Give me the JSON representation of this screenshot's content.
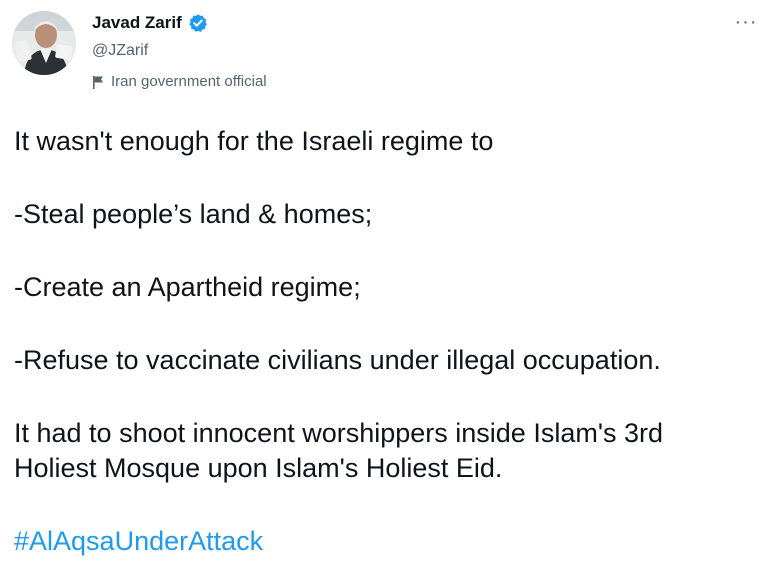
{
  "author": {
    "display_name": "Javad Zarif",
    "handle": "@JZarif",
    "label": "Iran government official",
    "verified_icon": "verified-badge-icon",
    "label_icon": "flag-icon"
  },
  "menu": {
    "more_label": "···"
  },
  "tweet": {
    "lines": [
      "It wasn't enough for the Israeli regime to",
      "-Steal people’s land & homes;",
      "-Create an Apartheid regime;",
      "-Refuse to vaccinate civilians under illegal occupation.",
      "It had to shoot innocent worshippers inside Islam's 3rd",
      "Holiest Mosque upon Islam's Holiest Eid."
    ],
    "hashtag": "#AlAqsaUnderAttack"
  },
  "colors": {
    "link": "#1d9bf0",
    "secondary_text": "#536471",
    "primary_text": "#0f1419",
    "verified": "#1d9bf0"
  }
}
